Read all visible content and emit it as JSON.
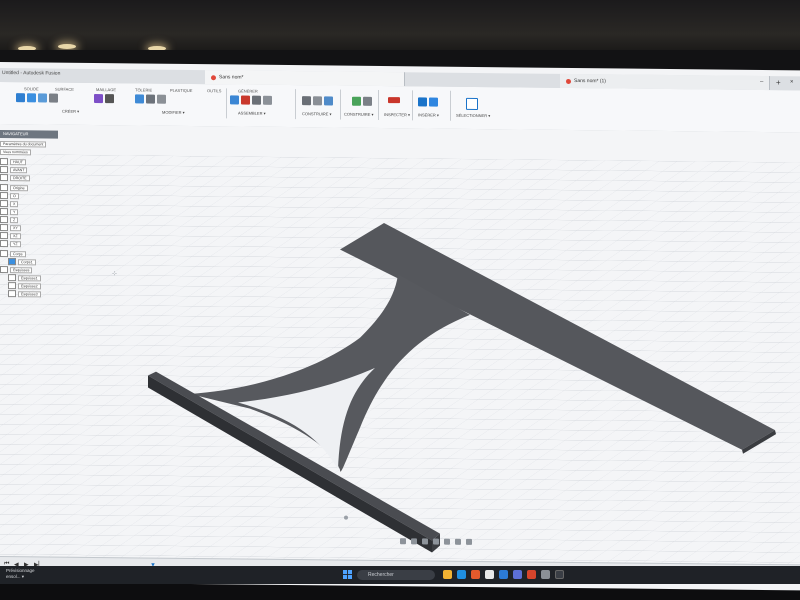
{
  "window": {
    "title": "Untitled - Autodesk Fusion",
    "tabs": [
      {
        "label": "Sans nom*"
      },
      {
        "label": "Sans nom* (1)"
      }
    ],
    "win_min": "–",
    "win_close": "×",
    "tab_add": "+"
  },
  "toolbar": {
    "groups": [
      {
        "label": "SOLIDE",
        "menu": "CRÉER ▾"
      },
      {
        "label": "SURFACE",
        "menu": ""
      },
      {
        "label": "MAILLAGE",
        "menu": ""
      },
      {
        "label": "TÔLERIE",
        "menu": ""
      },
      {
        "label": "PLASTIQUE",
        "menu": ""
      },
      {
        "label": "OUTILS",
        "menu": ""
      },
      {
        "label": "GÉNÉRER",
        "menu": "MODIFIER ▾"
      },
      {
        "label": "",
        "menu": "ASSEMBLER ▾"
      },
      {
        "label": "",
        "menu": "CONSTRUIRE ▾"
      },
      {
        "label": "",
        "menu": "CONSTRUIRE ▾"
      },
      {
        "label": "",
        "menu": "INSPECTER ▾"
      },
      {
        "label": "",
        "menu": "INSÉRER ▾"
      },
      {
        "label": "",
        "menu": "SÉLECTIONNER ▾"
      }
    ]
  },
  "browser": {
    "header": "NAVIGATEUR",
    "rows": [
      {
        "label": "Paramètres du document"
      },
      {
        "label": "Vues nommées"
      },
      {
        "label": "HAUT"
      },
      {
        "label": "AVANT"
      },
      {
        "label": "DROITE"
      },
      {
        "label": "Origine"
      },
      {
        "label": "O"
      },
      {
        "label": "X"
      },
      {
        "label": "Y"
      },
      {
        "label": "Z"
      },
      {
        "label": "XY"
      },
      {
        "label": "XZ"
      },
      {
        "label": "YZ"
      },
      {
        "label": "Corps"
      },
      {
        "label": "Corps1"
      },
      {
        "label": "Esquisses"
      },
      {
        "label": "Esquisse1"
      },
      {
        "label": "Esquisse2"
      },
      {
        "label": "Esquisse3"
      }
    ]
  },
  "taskbar": {
    "search_placeholder": "Rechercher",
    "tray_text": "Prévisionnage ensol... ▾"
  },
  "colors": {
    "model": "#5b5d62",
    "model_dark": "#3e4045",
    "grid": "#c9cdd3",
    "accent": "#1a73c9"
  }
}
